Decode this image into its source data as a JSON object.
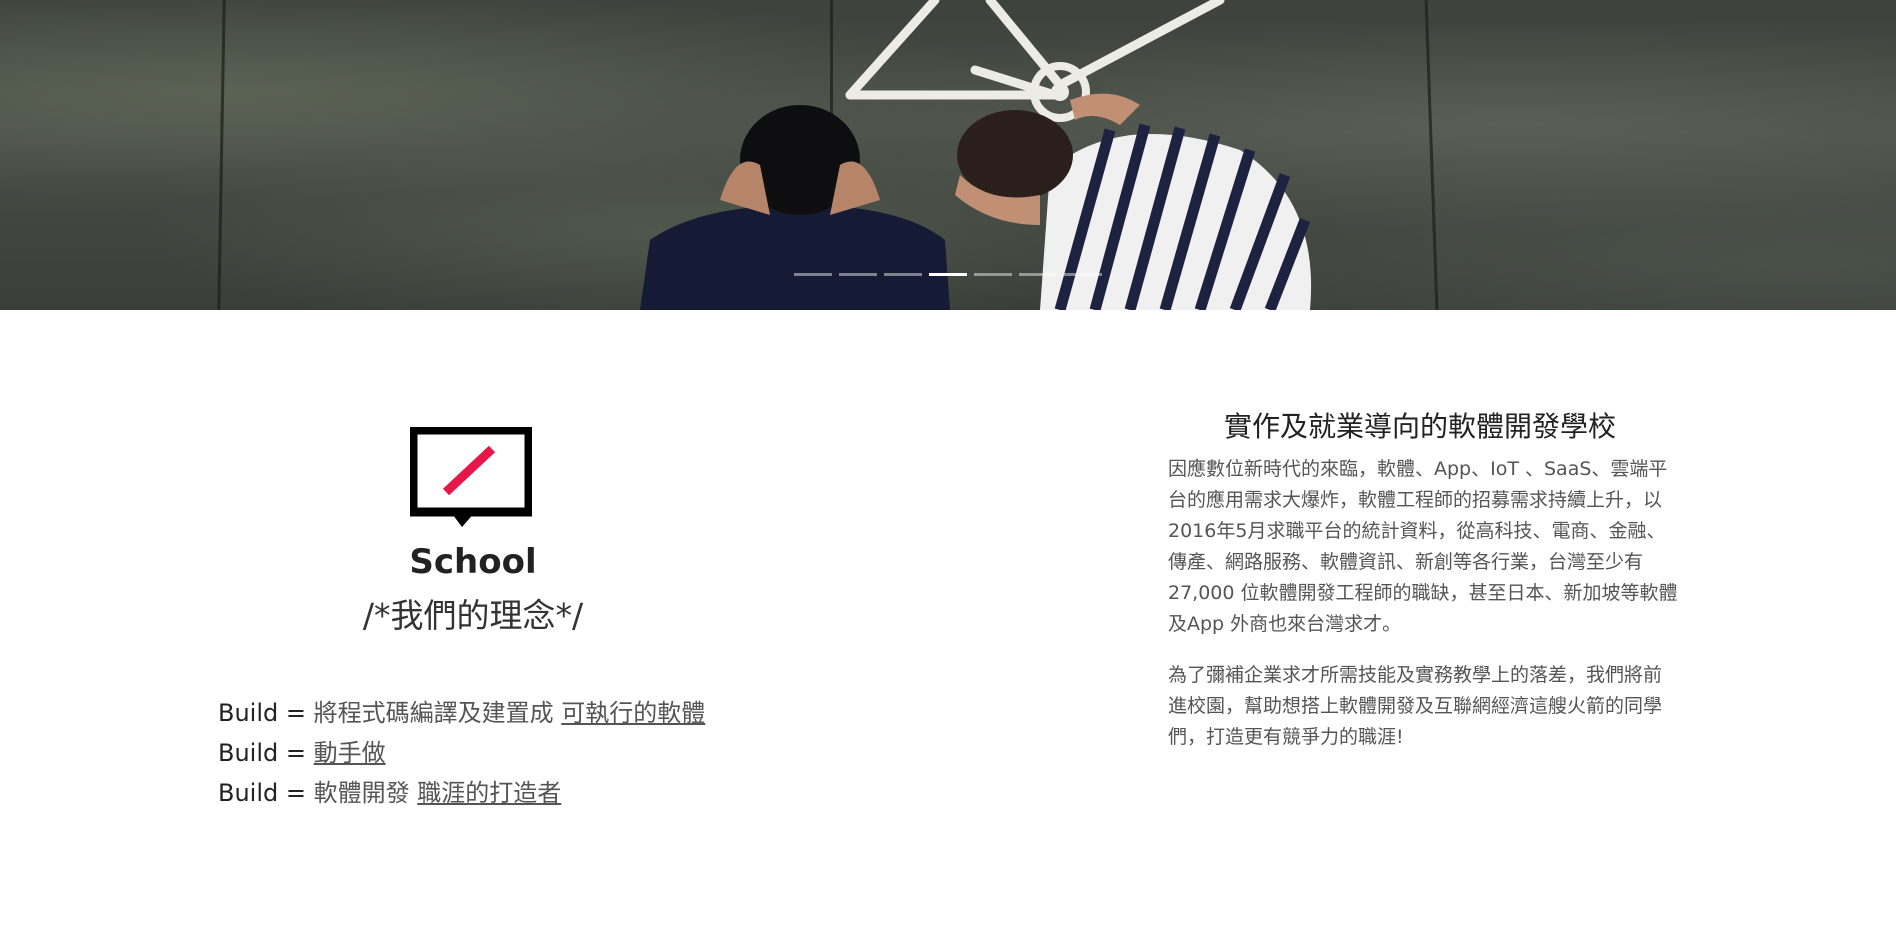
{
  "hero": {
    "carousel": {
      "slide_count": 7,
      "active_index": 3
    }
  },
  "left": {
    "logo_icon": "school-slash-logo-icon",
    "title": "School",
    "subtitle": "/*我們的理念*/",
    "build_lines": [
      {
        "key": "Build = ",
        "text": "將程式碼編譯及建置成 ",
        "link": "可執行的軟體"
      },
      {
        "key": "Build = ",
        "text": "",
        "link": "動手做"
      },
      {
        "key": "Build = ",
        "text": "軟體開發 ",
        "link": "職涯的打造者"
      }
    ]
  },
  "right": {
    "heading": "實作及就業導向的軟體開發學校",
    "paragraph_1": "因應數位新時代的來臨，軟體、App、IoT 、SaaS、雲端平台的應用需求大爆炸，軟體工程師的招募需求持續上升，以2016年5月求職平台的統計資料，從高科技、電商、金融、傳產、網路服務、軟體資訊、新創等各行業，台灣至少有 27,000 位軟體開發工程師的職缺，甚至日本、新加坡等軟體及App 外商也來台灣求才。",
    "paragraph_2": "為了彌補企業求才所需技能及實務教學上的落差，我們將前進校園，幫助想搭上軟體開發及互聯網經濟這艘火箭的同學們，打造更有競爭力的職涯!"
  },
  "colors": {
    "accent": "#e8174a",
    "logo_frame": "#000000",
    "text_dark": "#222222",
    "text_body": "#555555"
  }
}
